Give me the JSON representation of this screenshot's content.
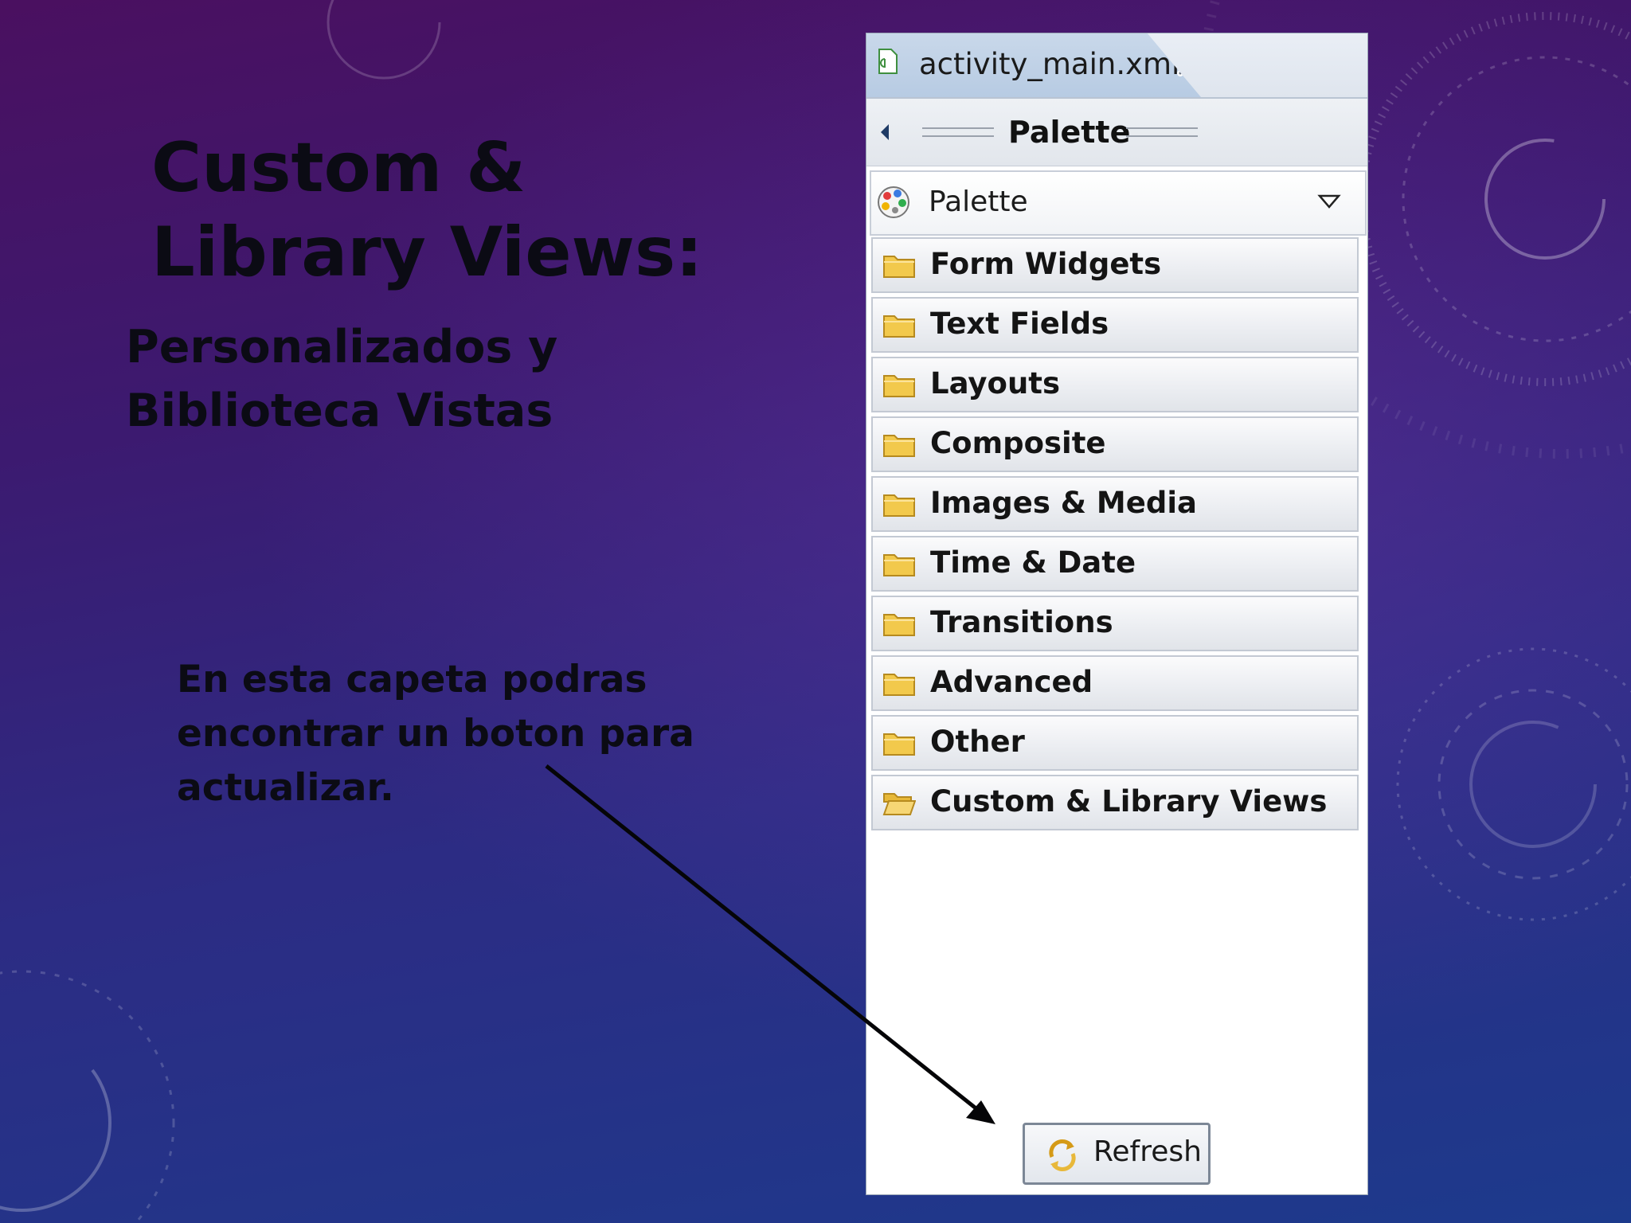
{
  "slide": {
    "title_lines": [
      "Custom &",
      "Library Views:"
    ],
    "subtitle_lines": [
      "Personalizados y",
      "Biblioteca Vistas"
    ],
    "note_lines": [
      "En esta capeta podras",
      "encontrar un boton para",
      "actualizar."
    ],
    "background_colors": [
      "#4a1060",
      "#2c2c84",
      "#1d3a8c"
    ]
  },
  "editor": {
    "tab_filename": "activity_main.xml",
    "tab_icons": {
      "file": "xml-file-icon",
      "close": "close-icon"
    }
  },
  "palette": {
    "header_label": "Palette",
    "selector": {
      "value": "Palette",
      "icon": "palette-icon",
      "dropdown_icon": "dropdown-arrow-icon"
    },
    "drawers": [
      {
        "label": "Form Widgets",
        "icon": "folder-closed-icon",
        "open": false
      },
      {
        "label": "Text Fields",
        "icon": "folder-closed-icon",
        "open": false
      },
      {
        "label": "Layouts",
        "icon": "folder-closed-icon",
        "open": false
      },
      {
        "label": "Composite",
        "icon": "folder-closed-icon",
        "open": false
      },
      {
        "label": "Images & Media",
        "icon": "folder-closed-icon",
        "open": false
      },
      {
        "label": "Time & Date",
        "icon": "folder-closed-icon",
        "open": false
      },
      {
        "label": "Transitions",
        "icon": "folder-closed-icon",
        "open": false
      },
      {
        "label": "Advanced",
        "icon": "folder-closed-icon",
        "open": false
      },
      {
        "label": "Other",
        "icon": "folder-closed-icon",
        "open": false
      },
      {
        "label": "Custom & Library Views",
        "icon": "folder-open-icon",
        "open": true
      }
    ],
    "refresh_button": {
      "label": "Refresh",
      "icon": "refresh-icon"
    }
  },
  "colors": {
    "folder": "#f2c94c",
    "panel_tab": "#bcd0e6",
    "text_dark": "#0b0b14"
  }
}
